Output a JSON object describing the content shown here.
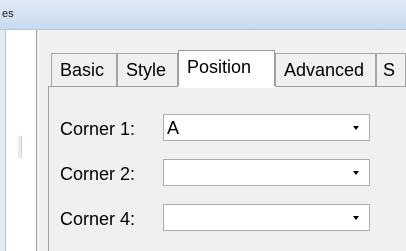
{
  "window": {
    "title_fragment": "es"
  },
  "tabs": [
    {
      "label": "Basic"
    },
    {
      "label": "Style"
    },
    {
      "label": "Position"
    },
    {
      "label": "Advanced"
    },
    {
      "label": "S"
    }
  ],
  "active_tab": "Position",
  "fields": [
    {
      "label": "Corner 1:",
      "value": "A"
    },
    {
      "label": "Corner 2:",
      "value": ""
    },
    {
      "label": "Corner 4:",
      "value": ""
    }
  ],
  "colors": {
    "titlebar": "#c9daf0",
    "panel_background": "#f0f0f0",
    "active_tab": "#ffffff"
  }
}
